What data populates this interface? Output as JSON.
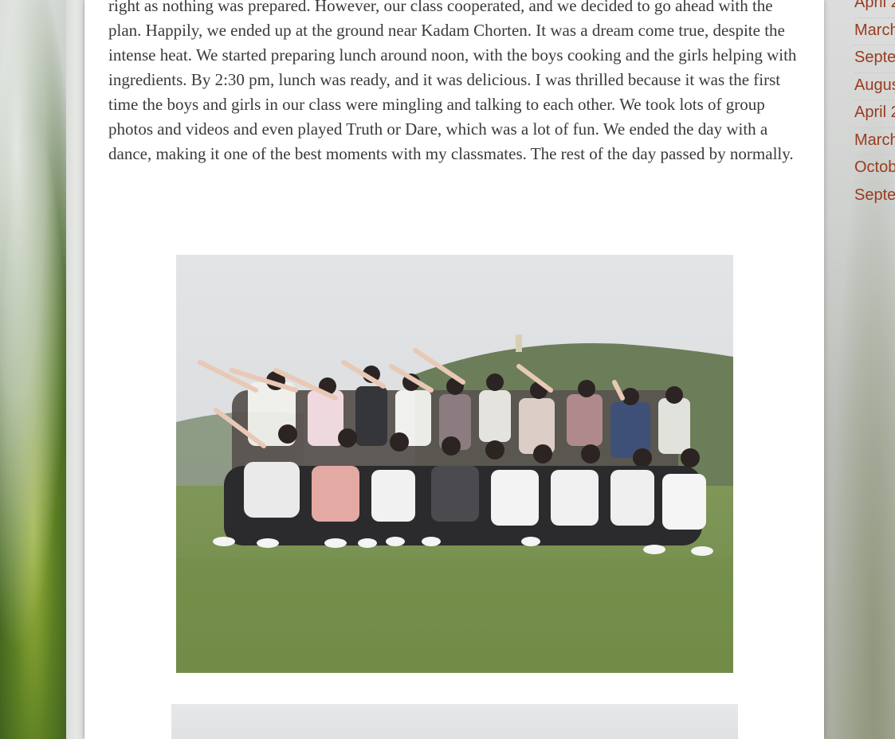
{
  "post": {
    "paragraph": "right as nothing was prepared. However, our class cooperated, and we decided to go ahead with the plan. Happily, we ended up at the ground near Kadam Chorten. It was a dream come true, despite the intense heat. We started preparing lunch around noon, with the boys cooking and the girls helping with ingredients. By 2:30 pm, lunch was ready, and it was delicious. I was thrilled because it was the first time the boys and girls in our class were mingling and talking to each other. We took lots of group photos and videos and even played Truth or Dare, which was a lot of fun. We ended the day with a dance, making it one of the best moments with my classmates. The rest of the day passed by normally."
  },
  "sidebar": {
    "archive": [
      {
        "label": "April 2"
      },
      {
        "label": "March"
      },
      {
        "label": "Septe"
      },
      {
        "label": "Augus"
      },
      {
        "label": "April 2"
      },
      {
        "label": "March"
      },
      {
        "label": "Octob"
      },
      {
        "label": "Septe"
      }
    ]
  },
  "colors": {
    "link": "#9a3b1f",
    "body_text": "#3a3a3a",
    "content_bg": "#ffffff"
  }
}
